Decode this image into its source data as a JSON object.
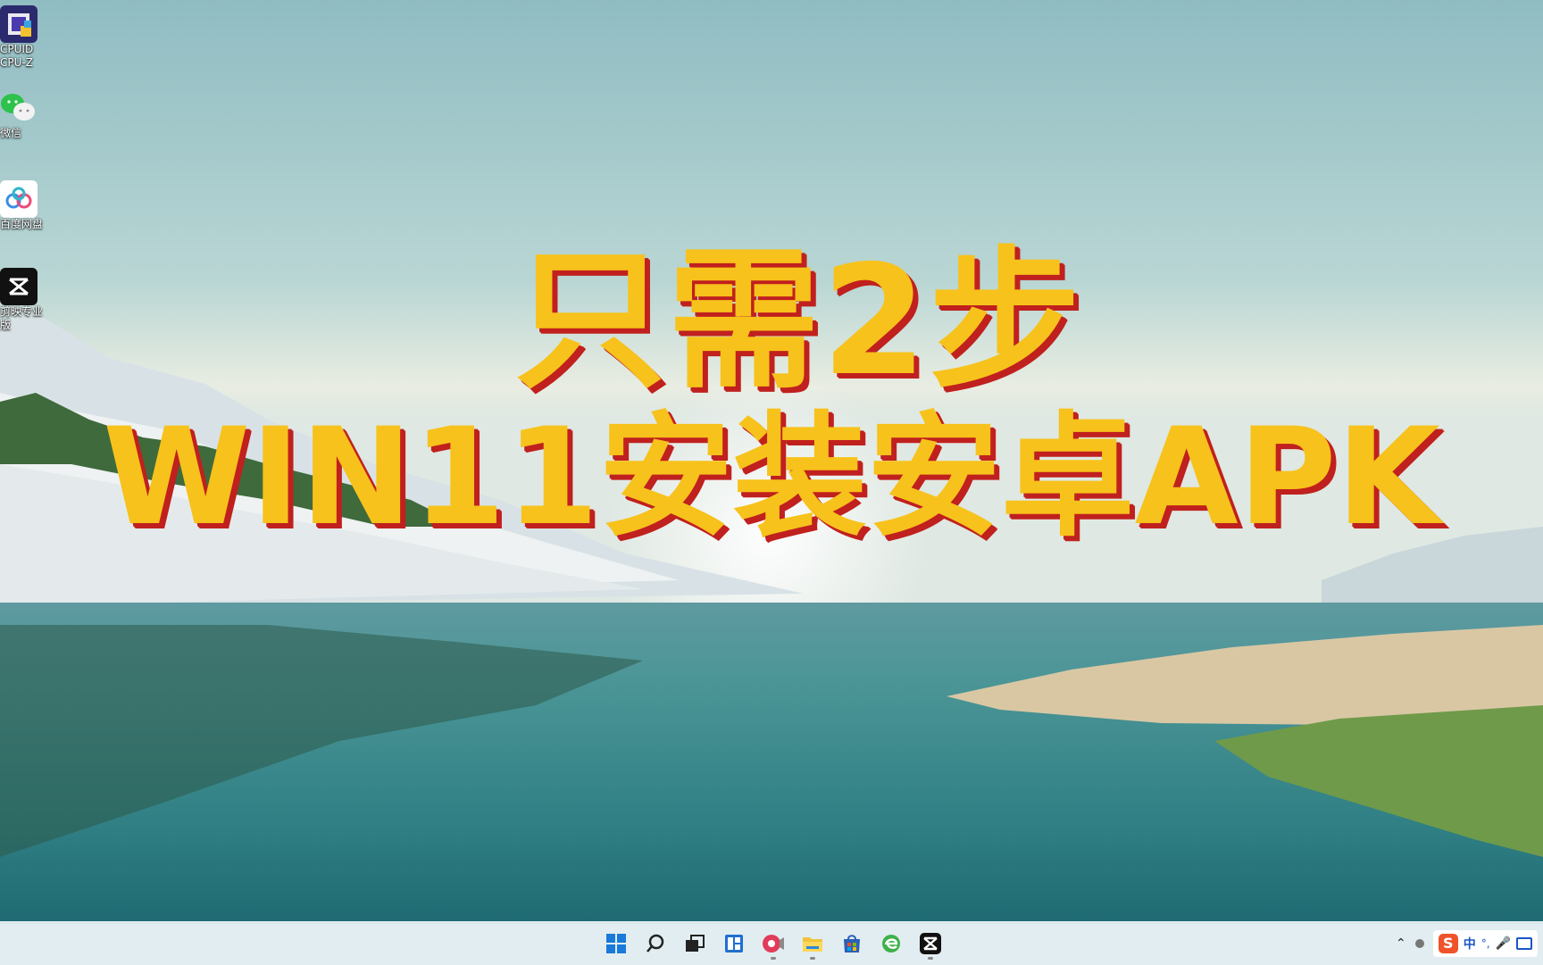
{
  "desktop": {
    "icons": [
      {
        "label": "CPUID\nCPU-Z",
        "icon": "cpuz-icon"
      },
      {
        "label": "微信",
        "icon": "wechat-icon"
      },
      {
        "label": "百度网盘",
        "icon": "baidu-netdisk-icon"
      },
      {
        "label": "剪映专业版",
        "icon": "capcut-icon"
      }
    ]
  },
  "overlay": {
    "line1": "只需2步",
    "line2": "WIN11安装安卓APK",
    "text_color": "#f7c21b",
    "shadow_color": "#c0201e"
  },
  "taskbar": {
    "apps": [
      {
        "icon": "windows-start-icon",
        "running": false
      },
      {
        "icon": "search-icon",
        "running": false
      },
      {
        "icon": "task-view-icon",
        "running": false
      },
      {
        "icon": "widgets-icon",
        "running": false
      },
      {
        "icon": "screen-recorder-icon",
        "running": true
      },
      {
        "icon": "file-explorer-icon",
        "running": true
      },
      {
        "icon": "microsoft-store-icon",
        "running": false
      },
      {
        "icon": "browser-icon",
        "running": false
      },
      {
        "icon": "capcut-icon",
        "running": true
      }
    ],
    "tray": {
      "ime_language": "中",
      "icons": [
        "chevron-up-icon",
        "status-icon",
        "sogou-ime-icon",
        "punctuation-icon",
        "microphone-icon",
        "keyboard-icon"
      ]
    }
  }
}
